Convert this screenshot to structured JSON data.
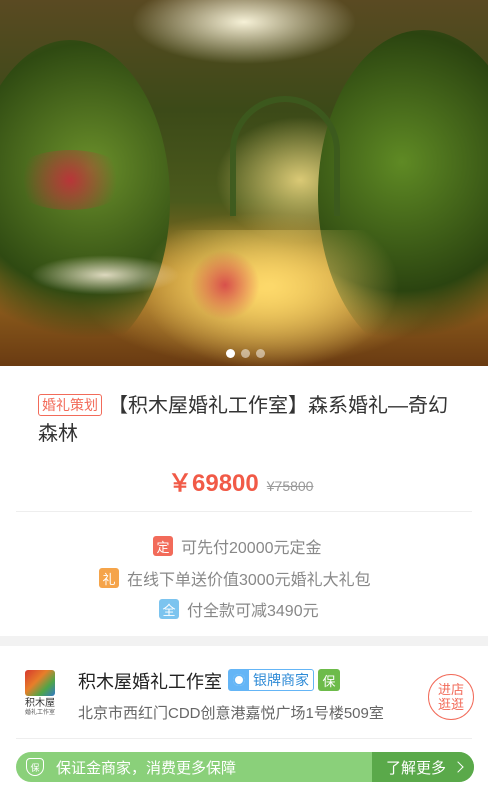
{
  "product": {
    "category_tag": "婚礼策划",
    "title": "【积木屋婚礼工作室】森系婚礼—奇幻森林",
    "price": "￥69800",
    "original_price": "¥75800",
    "carousel": {
      "total": 3,
      "active": 1
    }
  },
  "promotions": [
    {
      "badge": "定",
      "color": "#f26b5a",
      "text": "可先付20000元定金"
    },
    {
      "badge": "礼",
      "color": "#f5a44a",
      "text": "在线下单送价值3000元婚礼大礼包"
    },
    {
      "badge": "全",
      "color": "#7cc4ef",
      "text": "付全款可减3490元"
    }
  ],
  "shop": {
    "logo_name": "积木屋",
    "logo_sub": "婚礼工作室",
    "name": "积木屋婚礼工作室",
    "level": "银牌商家",
    "guarantee_badge": "保",
    "address": "北京市西红门CDD创意港嘉悦广场1号楼509室",
    "enter_button": [
      "进店",
      "逛逛"
    ]
  },
  "guarantee": {
    "icon_text": "保",
    "text": "保证金商家，消费更多保障",
    "more": "了解更多"
  },
  "colors": {
    "accent": "#f15a47",
    "guarantee_bg": "#8ad07a",
    "guarantee_btn": "#5aa94a",
    "level_blue": "#64b5f6"
  }
}
